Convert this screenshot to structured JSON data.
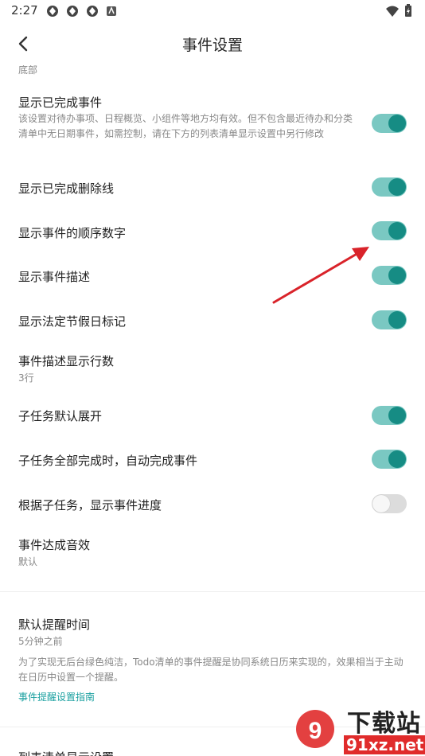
{
  "status_bar": {
    "time": "2:27",
    "left_icons": [
      "app-notification-icon",
      "app-notification-icon",
      "app-notification-icon",
      "app-badge-icon"
    ],
    "right_icons": [
      "wifi-icon",
      "battery-charging-icon"
    ]
  },
  "app_bar": {
    "title": "事件设置",
    "back_icon": "back-arrow-icon"
  },
  "cut_top_subtitle": "底部",
  "settings": {
    "show_completed": {
      "title": "显示已完成事件",
      "desc": "该设置对待办事项、日程概览、小组件等地方均有效。但不包含最近待办和分类清单中无日期事件，如需控制，请在下方的列表清单显示设置中另行修改",
      "enabled": true
    },
    "strikethrough": {
      "title": "显示已完成删除线",
      "enabled": true
    },
    "order_number": {
      "title": "显示事件的顺序数字",
      "enabled": true
    },
    "description": {
      "title": "显示事件描述",
      "enabled": true
    },
    "holiday": {
      "title": "显示法定节假日标记",
      "enabled": true
    },
    "desc_lines": {
      "title": "事件描述显示行数",
      "value": "3行"
    },
    "subtask_expand": {
      "title": "子任务默认展开",
      "enabled": true
    },
    "subtask_auto_complete": {
      "title": "子任务全部完成时，自动完成事件",
      "enabled": true
    },
    "subtask_progress": {
      "title": "根据子任务，显示事件进度",
      "enabled": false
    },
    "sound": {
      "title": "事件达成音效",
      "value": "默认"
    },
    "reminder": {
      "title": "默认提醒时间",
      "value": "5分钟之前",
      "desc": "为了实现无后台绿色纯洁，Todo清单的事件提醒是协同系统日历来实现的，效果相当于主动在日历中设置一个提醒。",
      "link": "事件提醒设置指南"
    },
    "list_display": {
      "title": "列表清单显示设置"
    }
  },
  "colors": {
    "toggle_on_track": "#7ac8c2",
    "toggle_on_knob": "#168c84",
    "toggle_off_track": "#dcdcdc",
    "link": "#1aa0a0",
    "annotation_arrow": "#d9232a"
  },
  "watermark": {
    "line1": "下载站",
    "line2": "91xz.net"
  }
}
